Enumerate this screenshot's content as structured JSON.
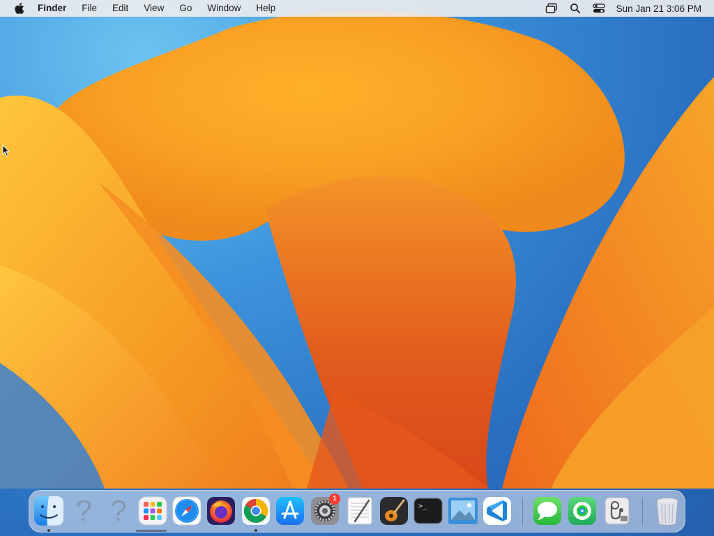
{
  "menubar": {
    "app_name": "Finder",
    "menus": [
      "File",
      "Edit",
      "View",
      "Go",
      "Window",
      "Help"
    ],
    "clock": "Sun Jan 21  3:06 PM",
    "status_icons": [
      "screen-mirroring-icon",
      "spotlight-search-icon",
      "control-center-icon"
    ]
  },
  "dock": {
    "apps": [
      {
        "name": "Finder",
        "icon": "finder-icon",
        "running": true
      },
      {
        "name": "Unknown",
        "icon": "question-mark-icon",
        "running": false
      },
      {
        "name": "Unknown",
        "icon": "question-mark-icon",
        "running": false
      },
      {
        "name": "Launchpad",
        "icon": "launchpad-icon",
        "running": false
      },
      {
        "name": "Safari",
        "icon": "safari-icon",
        "running": false
      },
      {
        "name": "Firefox",
        "icon": "firefox-icon",
        "running": false
      },
      {
        "name": "Chrome",
        "icon": "chrome-icon",
        "running": true
      },
      {
        "name": "App Store",
        "icon": "app-store-icon",
        "running": false
      },
      {
        "name": "System Settings",
        "icon": "system-settings-icon",
        "running": false,
        "badge": "1"
      },
      {
        "name": "TextEdit",
        "icon": "textedit-icon",
        "running": false
      },
      {
        "name": "GarageBand",
        "icon": "garageband-icon",
        "running": false
      },
      {
        "name": "Terminal",
        "icon": "terminal-icon",
        "running": false
      },
      {
        "name": "Preview",
        "icon": "preview-icon",
        "running": false
      },
      {
        "name": "Visual Studio Code",
        "icon": "vscode-icon",
        "running": false
      },
      {
        "name": "Messages",
        "icon": "messages-icon",
        "running": false
      },
      {
        "name": "Find My",
        "icon": "find-my-icon",
        "running": false
      },
      {
        "name": "Disk Utility",
        "icon": "disk-utility-icon",
        "running": false
      },
      {
        "name": "Trash",
        "icon": "trash-icon",
        "running": false
      }
    ],
    "badge_value": "1"
  },
  "colors": {
    "menubar_bg": "#ececee",
    "badge": "#ff3b30",
    "wallpaper_orange": "#f59a23",
    "wallpaper_blue": "#2f7fd0"
  }
}
